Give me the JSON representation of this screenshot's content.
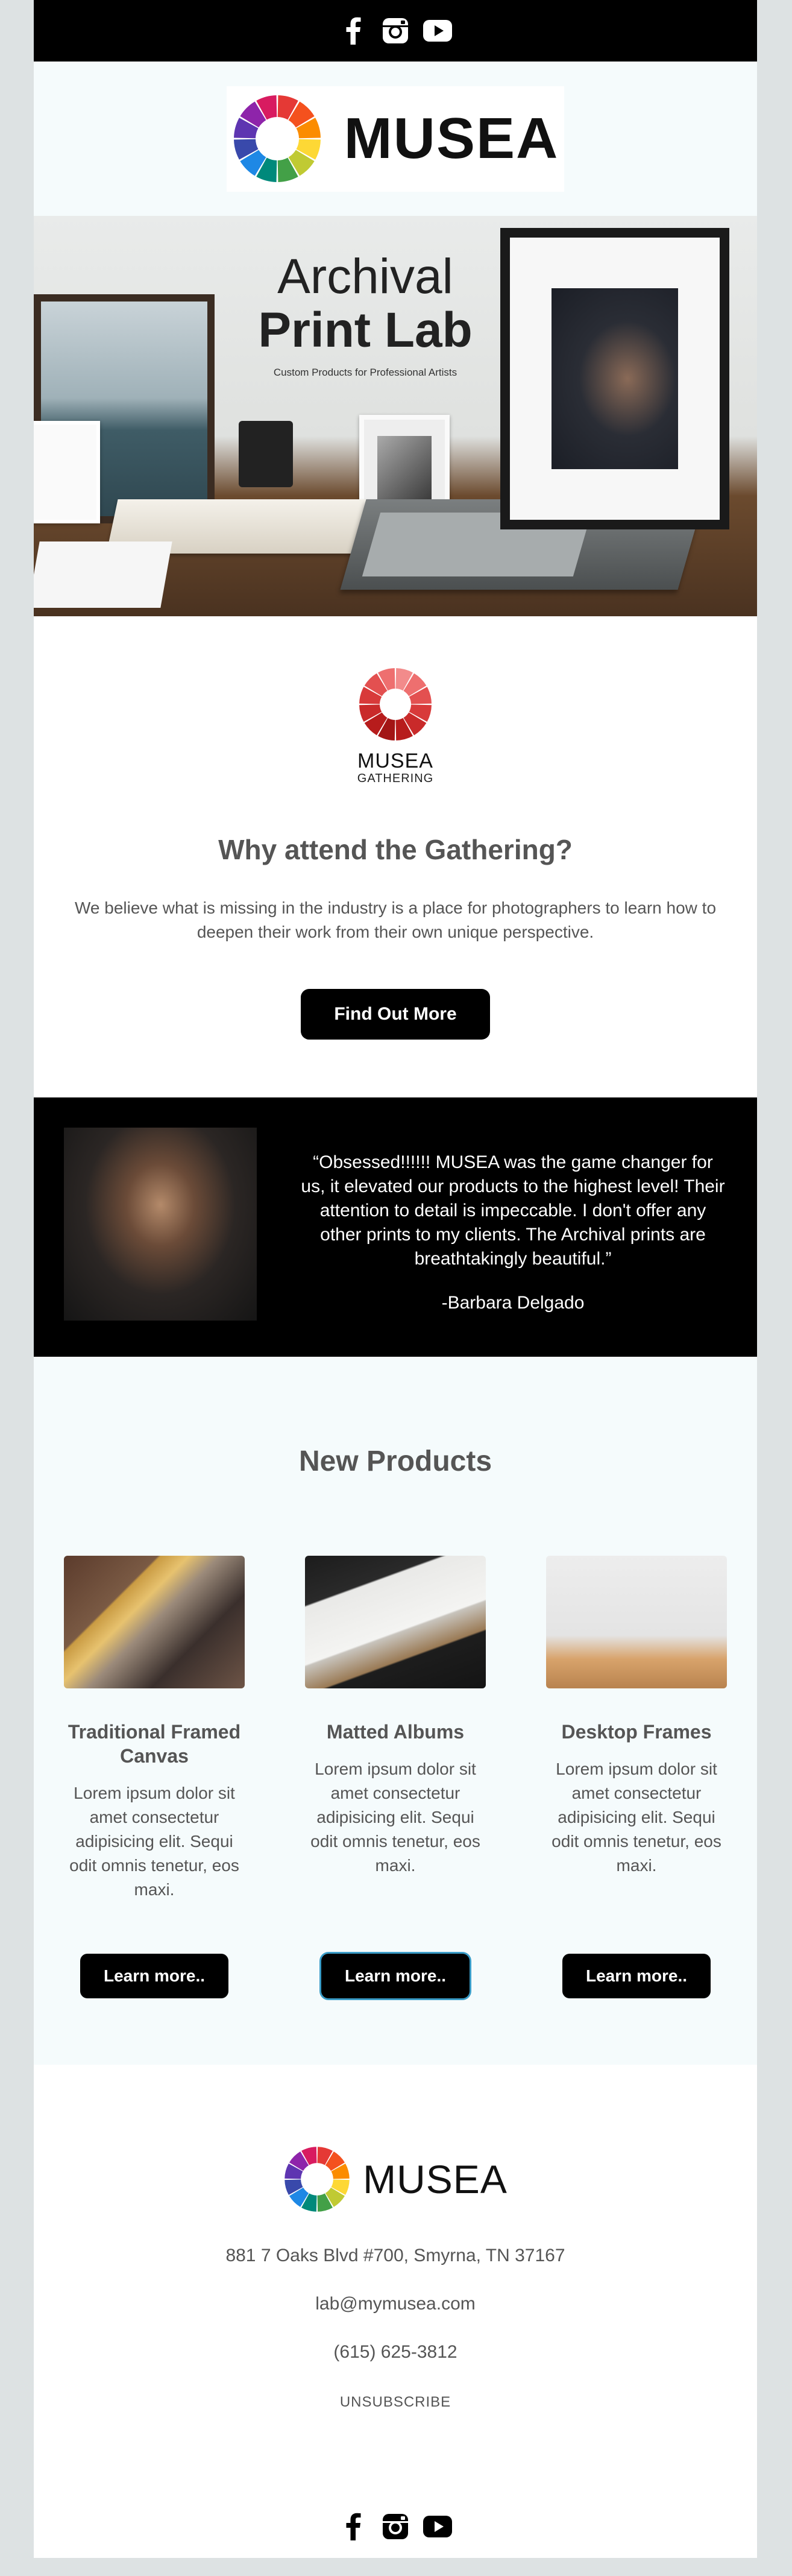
{
  "header": {
    "social": [
      "facebook-icon",
      "instagram-icon",
      "youtube-icon"
    ],
    "brand": "MUSEA"
  },
  "hero": {
    "title_line1": "Archival",
    "title_line2": "Print Lab",
    "subtitle": "Custom Products for Professional Artists"
  },
  "gathering": {
    "logo_brand": "MUSEA",
    "logo_sub": "GATHERING",
    "heading": "Why attend the Gathering?",
    "body": "We believe what is missing in the industry is a place for photographers to learn how to deepen their work from their own unique perspective.",
    "button": "Find Out More"
  },
  "testimonial": {
    "quote": "“Obsessed!!!!!! MUSEA was the game changer for us, it elevated our products to the highest level! Their attention to detail is impeccable. I don't offer any other prints to my clients. The Archival prints are breathtakingly beautiful.”",
    "author": "-Barbara Delgado"
  },
  "products": {
    "heading": "New Products",
    "items": [
      {
        "title": "Traditional Framed Canvas",
        "desc": "Lorem ipsum dolor sit amet consectetur adipisicing elit. Sequi odit omnis tenetur, eos maxi.",
        "button": "Learn more.."
      },
      {
        "title": "Matted Albums",
        "desc": "Lorem ipsum dolor sit amet consectetur adipisicing elit. Sequi odit omnis tenetur, eos maxi.",
        "button": "Learn more.."
      },
      {
        "title": "Desktop Frames",
        "desc": "Lorem ipsum dolor sit amet consectetur adipisicing elit. Sequi odit omnis tenetur, eos maxi.",
        "button": "Learn more.."
      }
    ]
  },
  "footer": {
    "brand": "MUSEA",
    "address": "881 7 Oaks Blvd #700, Smyrna, TN 37167",
    "email": "lab@mymusea.com",
    "phone": "(615) 625-3812",
    "unsubscribe": "UNSUBSCRIBE",
    "social": [
      "facebook-icon",
      "instagram-icon",
      "youtube-icon"
    ]
  },
  "colors": {
    "page_bg": "#dde2e3",
    "band_light": "#f5fbfc",
    "button_bg": "#000000",
    "selected_outline": "#3a9cc7"
  }
}
